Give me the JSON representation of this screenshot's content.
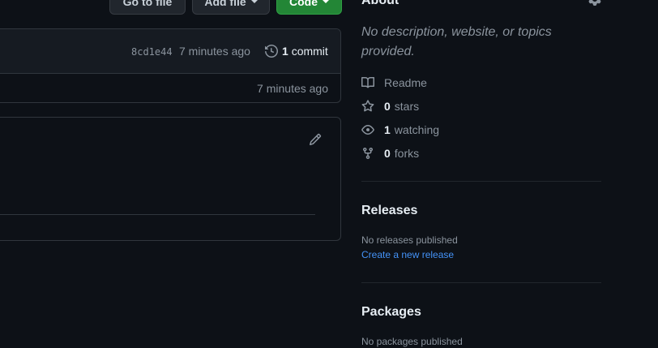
{
  "toolbar": {
    "goto_file": "Go to file",
    "add_file": "Add file",
    "code": "Code"
  },
  "commit": {
    "hash": "8cd1e44",
    "time": "7 minutes ago",
    "count": "1",
    "count_label": "commit",
    "row_time": "7 minutes ago"
  },
  "about": {
    "title": "About",
    "description": "No description, website, or topics provided.",
    "readme": "Readme",
    "stars_count": "0",
    "stars_label": "stars",
    "watching_count": "1",
    "watching_label": "watching",
    "forks_count": "0",
    "forks_label": "forks"
  },
  "releases": {
    "title": "Releases",
    "none": "No releases published",
    "create_link": "Create a new release"
  },
  "packages": {
    "title": "Packages",
    "none": "No packages published"
  },
  "colors": {
    "background": "#0d1117",
    "border": "#30363d",
    "muted": "#8b949e",
    "link": "#4493f8",
    "green": "#238636"
  }
}
